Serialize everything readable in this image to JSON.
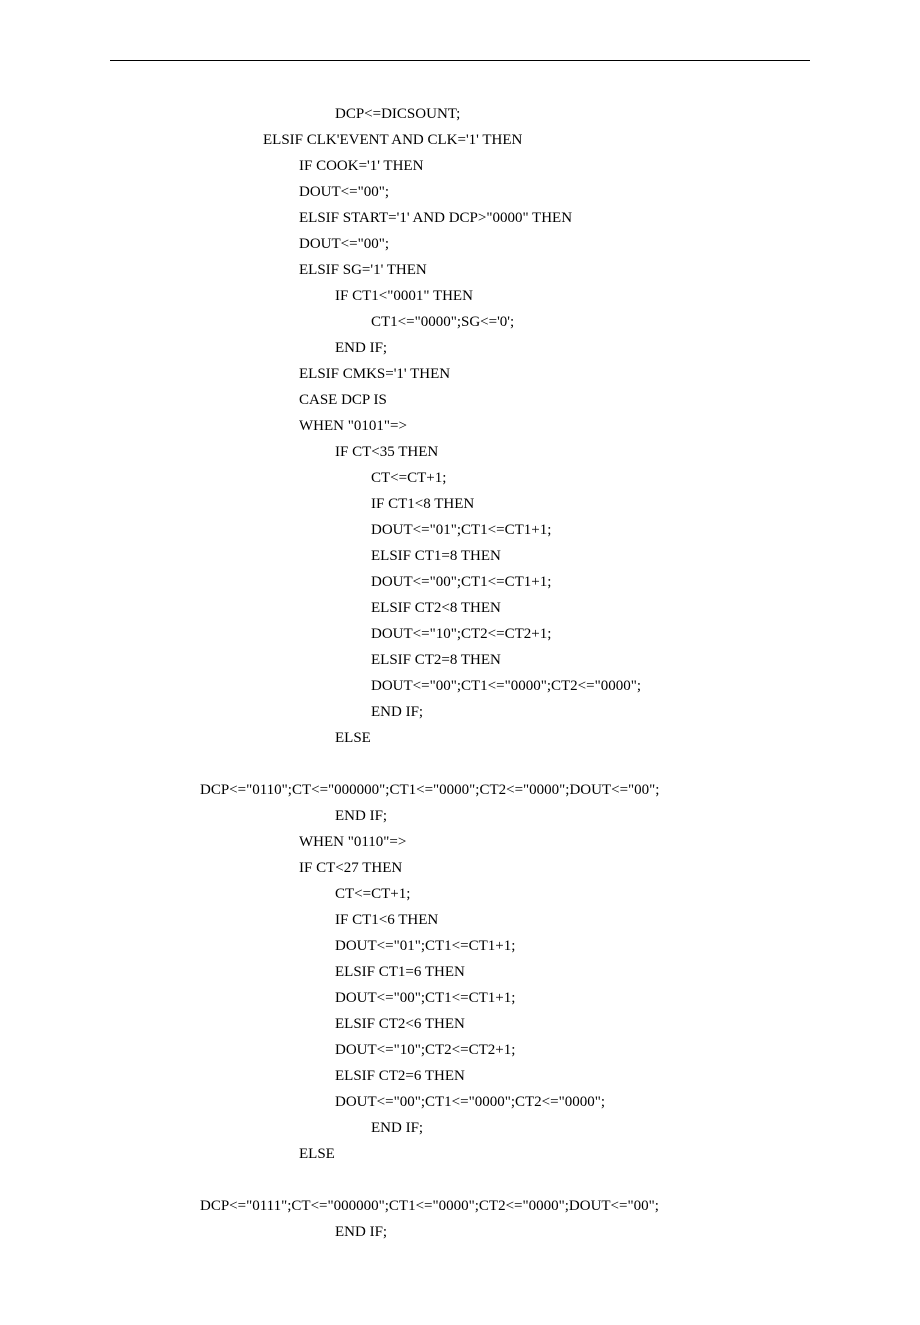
{
  "code": {
    "lines": [
      {
        "indent": 135,
        "text": "DCP<=DICSOUNT;"
      },
      {
        "indent": 63,
        "text": "ELSIF CLK'EVENT AND CLK='1' THEN"
      },
      {
        "indent": 99,
        "text": "IF COOK='1' THEN"
      },
      {
        "indent": 99,
        "text": "DOUT<=\"00\";"
      },
      {
        "indent": 99,
        "text": "ELSIF START='1' AND DCP>\"0000\" THEN"
      },
      {
        "indent": 99,
        "text": "DOUT<=\"00\";"
      },
      {
        "indent": 99,
        "text": "ELSIF SG='1' THEN"
      },
      {
        "indent": 135,
        "text": "IF CT1<\"0001\" THEN"
      },
      {
        "indent": 171,
        "text": "CT1<=\"0000\";SG<='0';"
      },
      {
        "indent": 135,
        "text": "END IF;"
      },
      {
        "indent": 99,
        "text": "ELSIF CMKS='1' THEN"
      },
      {
        "indent": 99,
        "text": "CASE DCP IS"
      },
      {
        "indent": 99,
        "text": "WHEN \"0101\"=>"
      },
      {
        "indent": 135,
        "text": "IF CT<35 THEN"
      },
      {
        "indent": 171,
        "text": "CT<=CT+1;"
      },
      {
        "indent": 171,
        "text": "IF CT1<8 THEN"
      },
      {
        "indent": 171,
        "text": "DOUT<=\"01\";CT1<=CT1+1;"
      },
      {
        "indent": 171,
        "text": "ELSIF CT1=8 THEN"
      },
      {
        "indent": 171,
        "text": "DOUT<=\"00\";CT1<=CT1+1;"
      },
      {
        "indent": 171,
        "text": "ELSIF CT2<8 THEN"
      },
      {
        "indent": 171,
        "text": "DOUT<=\"10\";CT2<=CT2+1;"
      },
      {
        "indent": 171,
        "text": "ELSIF CT2=8 THEN"
      },
      {
        "indent": 171,
        "text": "DOUT<=\"00\";CT1<=\"0000\";CT2<=\"0000\";"
      },
      {
        "indent": 171,
        "text": "END IF;"
      },
      {
        "indent": 135,
        "text": "ELSE"
      },
      {
        "indent": 0,
        "text": ""
      },
      {
        "indent": 0,
        "text": "DCP<=\"0110\";CT<=\"000000\";CT1<=\"0000\";CT2<=\"0000\";DOUT<=\"00\";"
      },
      {
        "indent": 135,
        "text": "END IF;"
      },
      {
        "indent": 99,
        "text": "WHEN \"0110\"=>"
      },
      {
        "indent": 99,
        "text": "IF CT<27 THEN"
      },
      {
        "indent": 135,
        "text": "CT<=CT+1;"
      },
      {
        "indent": 135,
        "text": "IF CT1<6 THEN"
      },
      {
        "indent": 135,
        "text": "DOUT<=\"01\";CT1<=CT1+1;"
      },
      {
        "indent": 135,
        "text": "ELSIF CT1=6 THEN"
      },
      {
        "indent": 135,
        "text": "DOUT<=\"00\";CT1<=CT1+1;"
      },
      {
        "indent": 135,
        "text": "ELSIF CT2<6 THEN"
      },
      {
        "indent": 135,
        "text": "DOUT<=\"10\";CT2<=CT2+1;"
      },
      {
        "indent": 135,
        "text": "ELSIF CT2=6 THEN"
      },
      {
        "indent": 135,
        "text": "DOUT<=\"00\";CT1<=\"0000\";CT2<=\"0000\";"
      },
      {
        "indent": 171,
        "text": "END IF;"
      },
      {
        "indent": 99,
        "text": "ELSE"
      },
      {
        "indent": 0,
        "text": ""
      },
      {
        "indent": 0,
        "text": "DCP<=\"0111\";CT<=\"000000\";CT1<=\"0000\";CT2<=\"0000\";DOUT<=\"00\";"
      },
      {
        "indent": 135,
        "text": "END IF;"
      }
    ]
  }
}
